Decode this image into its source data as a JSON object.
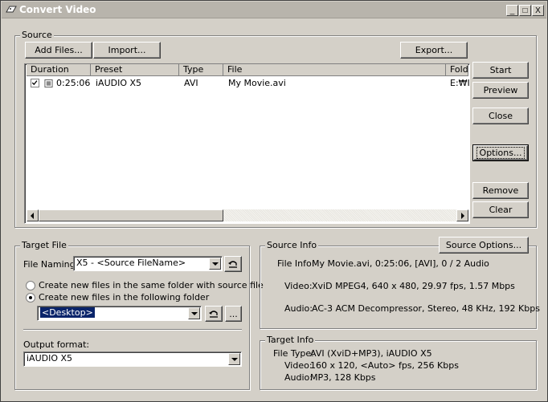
{
  "window": {
    "title": "Convert Video",
    "minimize_label": "_",
    "maximize_label": "□",
    "close_label": "X"
  },
  "source": {
    "group_label": "Source",
    "add_files_label": "Add Files...",
    "import_label": "Import...",
    "export_label": "Export...",
    "columns": [
      "Duration",
      "Preset",
      "Type",
      "File",
      "Folde"
    ],
    "rows": [
      {
        "checked": true,
        "duration": "0:25:06",
        "preset": "iAUDIO X5",
        "type": "AVI",
        "file": "My Movie.avi",
        "folder": "E:₩I"
      }
    ]
  },
  "actions": {
    "start_label": "Start",
    "preview_label": "Preview",
    "close_label": "Close",
    "options_label": "Options...",
    "remove_label": "Remove",
    "clear_label": "Clear"
  },
  "target_file": {
    "group_label": "Target File",
    "naming_label": "File Naming:",
    "naming_value": "X5 - <Source FileName>",
    "radio_same_label": "Create new files in the same folder with source file",
    "radio_following_label": "Create new files in the following folder",
    "folder_value": "<Desktop>",
    "browse_label": "...",
    "output_format_label": "Output format:",
    "output_format_value": "iAUDIO X5"
  },
  "source_info": {
    "group_label": "Source Info",
    "options_button_label": "Source Options...",
    "file_info_label": "File Info:",
    "file_info_value": "My Movie.avi, 0:25:06,  [AVI], 0 / 2 Audio",
    "video_label": "Video:",
    "video_value": "XviD MPEG4, 640 x 480, 29.97 fps, 1.57 Mbps",
    "audio_label": "Audio:",
    "audio_value": "AC-3 ACM Decompressor, Stereo, 48 KHz, 192 Kbps"
  },
  "target_info": {
    "group_label": "Target Info",
    "file_type_label": "File Type:",
    "file_type_value": "AVI (XviD+MP3), iAUDIO X5",
    "video_label": "Video:",
    "video_value": "160 x 120, <Auto> fps, 256 Kbps",
    "audio_label": "Audio:",
    "audio_value": "MP3, 128 Kbps"
  },
  "colors": {
    "face": "#d4d0c8",
    "selection": "#0a246a",
    "titlebar": "#b8b4ac"
  }
}
